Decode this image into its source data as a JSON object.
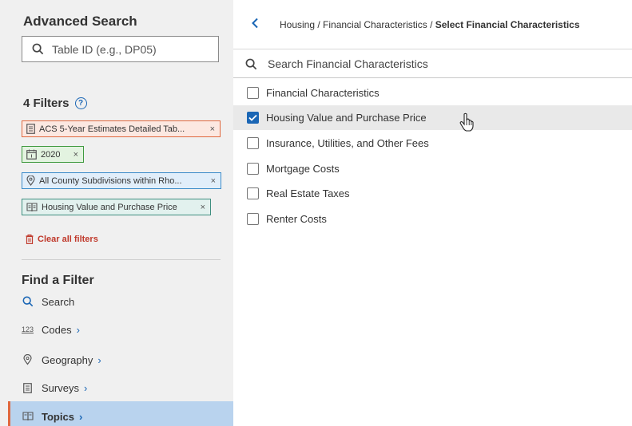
{
  "sidebar": {
    "title": "Advanced Search",
    "table_id_placeholder": "Table ID (e.g., DP05)",
    "filters_title": "4 Filters",
    "filters": [
      {
        "label": "ACS 5-Year Estimates Detailed Tab...",
        "icon": "survey-icon",
        "color": "#e0683e"
      },
      {
        "label": "2020",
        "icon": "calendar-icon",
        "color": "#3f9a3f"
      },
      {
        "label": "All County Subdivisions within Rho...",
        "icon": "location-pin-icon",
        "color": "#3b8bc9"
      },
      {
        "label": "Housing Value and Purchase Price",
        "icon": "book-icon",
        "color": "#3f8f80"
      }
    ],
    "remove_symbol": "×",
    "clear_all": "Clear all filters",
    "find_title": "Find a Filter",
    "nav": [
      {
        "label": "Search",
        "icon": "search-icon"
      },
      {
        "label": "Codes",
        "icon": "codes-icon",
        "icon_text": "123"
      },
      {
        "label": "Geography",
        "icon": "location-pin-icon"
      },
      {
        "label": "Surveys",
        "icon": "survey-icon"
      },
      {
        "label": "Topics",
        "icon": "book-icon",
        "active": true
      }
    ],
    "chevron": "›"
  },
  "main": {
    "breadcrumb_path": "Housing / Financial Characteristics / ",
    "breadcrumb_current": "Select Financial Characteristics",
    "search_placeholder": "Search Financial Characteristics",
    "options": [
      {
        "label": "Financial Characteristics",
        "checked": false
      },
      {
        "label": "Housing Value and Purchase Price",
        "checked": true
      },
      {
        "label": "Insurance, Utilities, and Other Fees",
        "checked": false
      },
      {
        "label": "Mortgage Costs",
        "checked": false
      },
      {
        "label": "Real Estate Taxes",
        "checked": false
      },
      {
        "label": "Renter Costs",
        "checked": false
      }
    ]
  },
  "colors": {
    "accent": "#1a66b5",
    "active_nav": "#b9d3ee",
    "danger": "#c0392b"
  }
}
